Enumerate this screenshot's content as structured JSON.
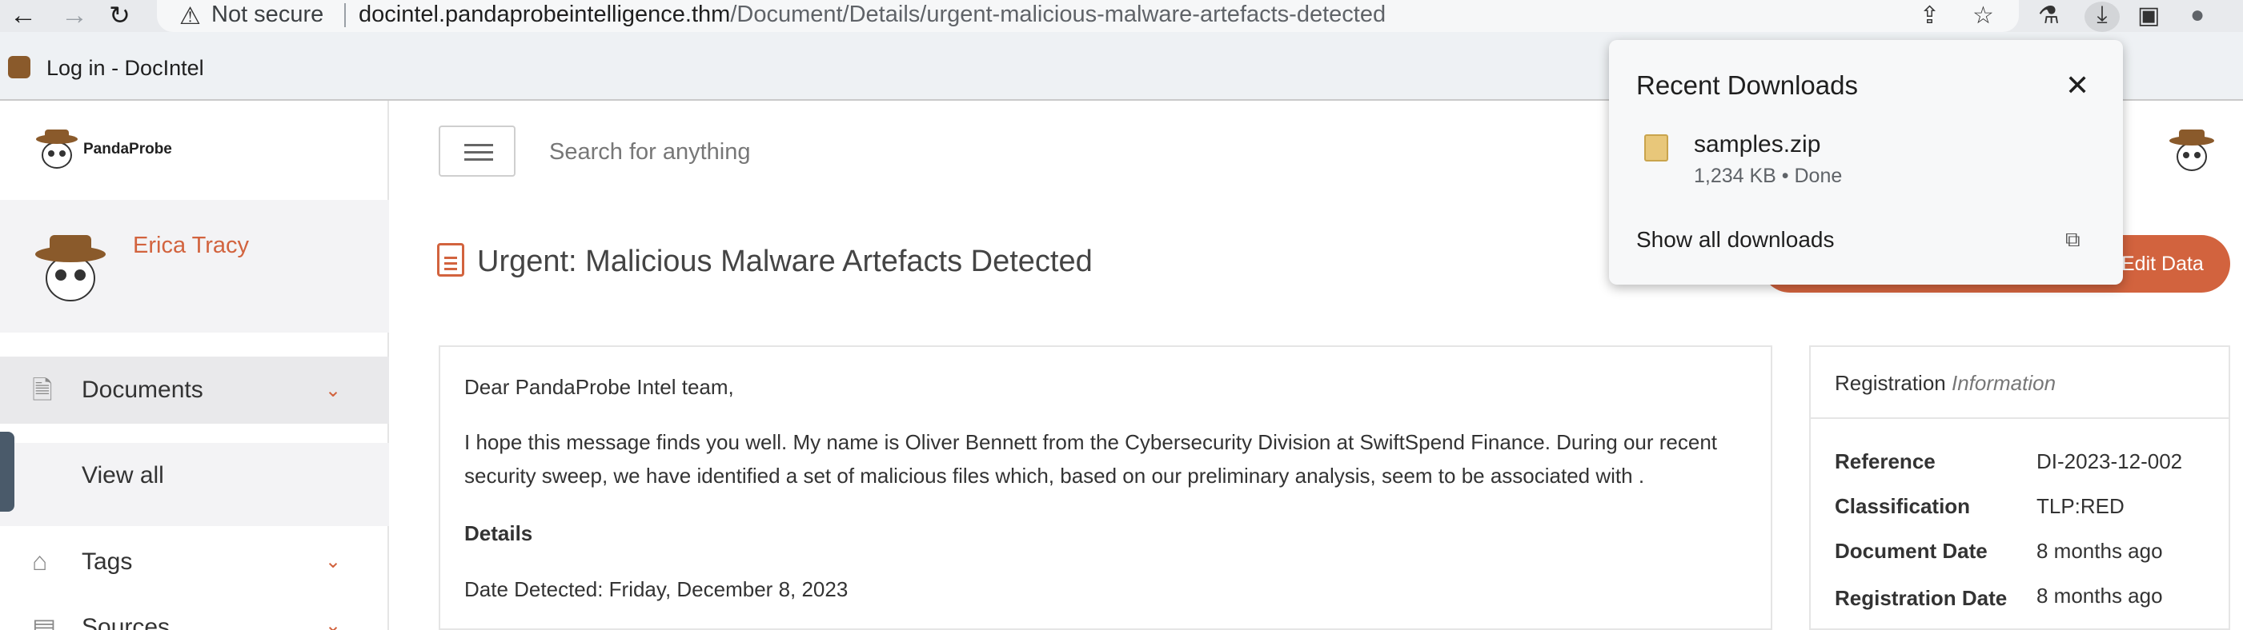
{
  "browser": {
    "security_label": "Not secure",
    "url_host": "docintel.pandaprobeintelligence.thm",
    "url_path": "/Document/Details/urgent-malicious-malware-artefacts-detected",
    "bookmark_label": "Log in - DocIntel"
  },
  "downloads": {
    "title": "Recent Downloads",
    "close": "✕",
    "file_name": "samples.zip",
    "file_meta": "1,234 KB • Done",
    "show_all": "Show all downloads"
  },
  "sidebar": {
    "logo_text": "PandaProbe",
    "user_name": "Erica Tracy",
    "items": [
      {
        "label": "Documents"
      },
      {
        "label": "View all"
      },
      {
        "label": "Tags"
      },
      {
        "label": "Sources"
      }
    ]
  },
  "header": {
    "search_placeholder": "Search for anything"
  },
  "page": {
    "title": "Urgent: Malicious Malware Artefacts Detected",
    "action_label": "Edit Data"
  },
  "document": {
    "greeting": "Dear PandaProbe Intel team,",
    "para1_line1": "I hope this message finds you well. My name is Oliver Bennett from the Cybersecurity Division at SwiftSpend Finance. During our recent",
    "para1_line2": "security sweep, we have identified a set of malicious files which, based on our preliminary analysis, seem to be associated with .",
    "details_heading": "Details",
    "date_detected": "Date Detected: Friday, December 8, 2023"
  },
  "registration": {
    "title": "Registration",
    "title_emphasis": "Information",
    "rows": [
      {
        "key": "Reference",
        "value": "DI-2023-12-002"
      },
      {
        "key": "Classification",
        "value": "TLP:RED"
      },
      {
        "key": "Document Date",
        "value": "8 months ago"
      },
      {
        "key": "Registration Date",
        "value": "8 months ago"
      }
    ]
  }
}
